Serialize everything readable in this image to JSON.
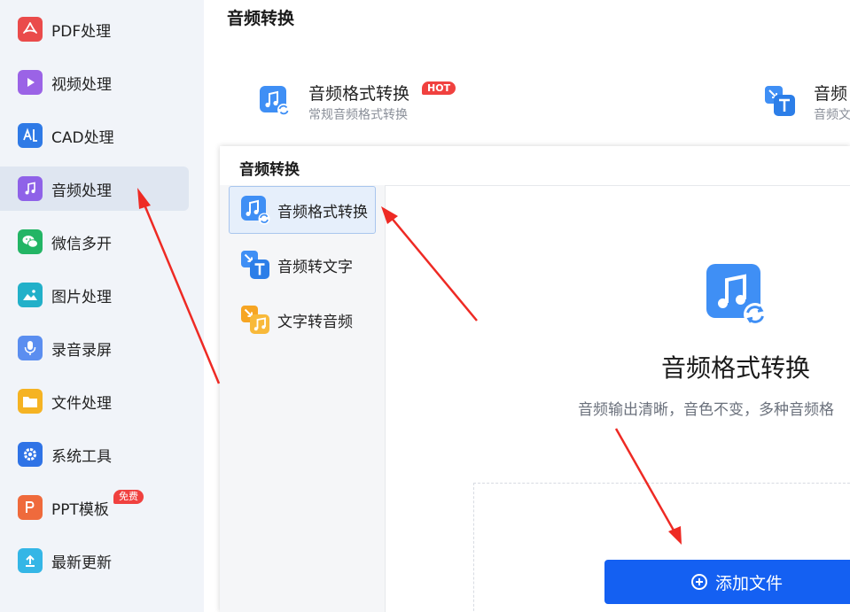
{
  "sidebar": {
    "items": [
      {
        "label": "PDF处理",
        "icon": "pdf-icon",
        "color": "#ea4b4b"
      },
      {
        "label": "视频处理",
        "icon": "video-play-icon",
        "color": "#9b63e6"
      },
      {
        "label": "CAD处理",
        "icon": "cad-icon",
        "color": "#2f7ae6"
      },
      {
        "label": "音频处理",
        "icon": "music-note-icon",
        "color": "#8f62e8",
        "active": true
      },
      {
        "label": "微信多开",
        "icon": "wechat-icon",
        "color": "#23b565"
      },
      {
        "label": "图片处理",
        "icon": "image-icon",
        "color": "#22b0c9"
      },
      {
        "label": "录音录屏",
        "icon": "microphone-icon",
        "color": "#5b8ef0"
      },
      {
        "label": "文件处理",
        "icon": "folder-icon",
        "color": "#f5b323"
      },
      {
        "label": "系统工具",
        "icon": "gear-icon",
        "color": "#2f73e6"
      },
      {
        "label": "PPT模板",
        "icon": "ppt-icon",
        "color": "#ef6a3c",
        "badge": "免费"
      },
      {
        "label": "最新更新",
        "icon": "upload-icon",
        "color": "#34b6e6"
      }
    ]
  },
  "main": {
    "title": "音频转换",
    "features": [
      {
        "title": "音频格式转换",
        "desc": "常规音频格式转换",
        "badge": "HOT",
        "icon": "audio-convert-icon"
      },
      {
        "title": "音频",
        "desc": "音频文",
        "icon": "audio-to-text-icon"
      }
    ]
  },
  "panel": {
    "title": "音频转换",
    "items": [
      {
        "label": "音频格式转换",
        "icon": "audio-convert-icon",
        "selected": true
      },
      {
        "label": "音频转文字",
        "icon": "audio-to-text-icon"
      },
      {
        "label": "文字转音频",
        "icon": "text-to-audio-icon"
      }
    ],
    "detail": {
      "title": "音频格式转换",
      "desc": "音频输出清晰，音色不变，多种音频格",
      "add_button": "添加文件"
    }
  },
  "colors": {
    "accent": "#1460f2",
    "badge_red": "#f0413f",
    "arrow": "#ee2a24"
  }
}
